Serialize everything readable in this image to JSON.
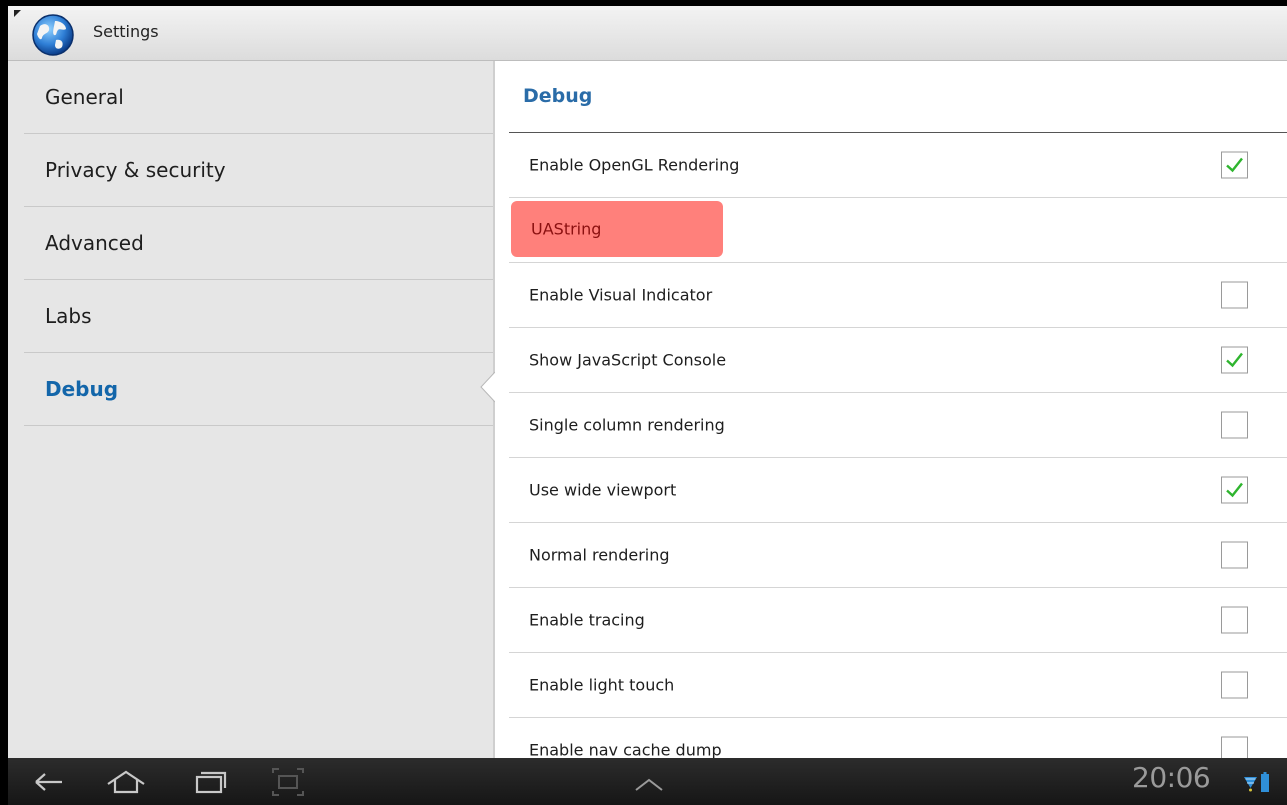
{
  "actionbar": {
    "title": "Settings",
    "icon": "browser-globe-icon"
  },
  "headers": [
    {
      "label": "General",
      "selected": false
    },
    {
      "label": "Privacy & security",
      "selected": false
    },
    {
      "label": "Advanced",
      "selected": false
    },
    {
      "label": "Labs",
      "selected": false
    },
    {
      "label": "Debug",
      "selected": true
    }
  ],
  "pane": {
    "section_title": "Debug",
    "rows": [
      {
        "label": "Enable OpenGL Rendering",
        "checkbox": true,
        "checked": true
      },
      {
        "label": "UAString",
        "checkbox": false,
        "highlighted": true
      },
      {
        "label": "Enable Visual Indicator",
        "checkbox": true,
        "checked": false
      },
      {
        "label": "Show JavaScript Console",
        "checkbox": true,
        "checked": true
      },
      {
        "label": "Single column rendering",
        "checkbox": true,
        "checked": false
      },
      {
        "label": "Use wide viewport",
        "checkbox": true,
        "checked": true
      },
      {
        "label": "Normal rendering",
        "checkbox": true,
        "checked": false
      },
      {
        "label": "Enable tracing",
        "checkbox": true,
        "checked": false
      },
      {
        "label": "Enable light touch",
        "checkbox": true,
        "checked": false
      },
      {
        "label": "Enable nav cache dump",
        "checkbox": true,
        "checked": false
      }
    ]
  },
  "systembar": {
    "time": "20:06",
    "nav_icons": [
      "back-icon",
      "home-icon",
      "recent-apps-icon",
      "screenshot-icon",
      "expand-up-icon"
    ],
    "status_icons": [
      "wifi-icon",
      "battery-icon"
    ]
  },
  "colors": {
    "accent": "#1366aa",
    "highlight": "#ff807b",
    "check_green": "#2fb52f"
  }
}
